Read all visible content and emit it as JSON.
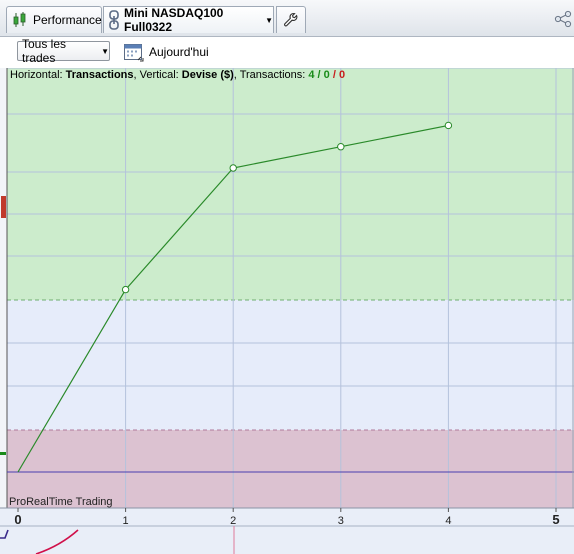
{
  "tabs": {
    "performance_label": "Performance",
    "instrument_label": "Mini NASDAQ100 Full0322"
  },
  "toolbar": {
    "trade_filter_value": "Tous les trades",
    "today_label": "Aujourd'hui"
  },
  "info": {
    "horizontal_prefix": "Horizontal: ",
    "horizontal_value": "Transactions",
    "vertical_prefix": ", Vertical: ",
    "vertical_value": "Devise ($)",
    "transactions_prefix": ", Transactions: ",
    "total": "4",
    "winners": "0",
    "losers": "0",
    "sep": " / "
  },
  "watermark": "ProRealTime Trading",
  "colors": {
    "gain_zone": "#cceccc",
    "neutral_zone": "#e6ecfa",
    "loss_zone": "#dcc2d1",
    "line": "#2a8a2a",
    "zero_line": "#4a3fb0"
  },
  "chart_data": {
    "type": "line",
    "x": [
      0,
      1,
      2,
      3,
      4
    ],
    "y": [
      0,
      0.6,
      1.0,
      1.07,
      1.14
    ],
    "x_ticks": [
      "0",
      "1",
      "2",
      "3",
      "4",
      "5"
    ],
    "xlim": [
      0,
      5
    ],
    "grid": true
  }
}
